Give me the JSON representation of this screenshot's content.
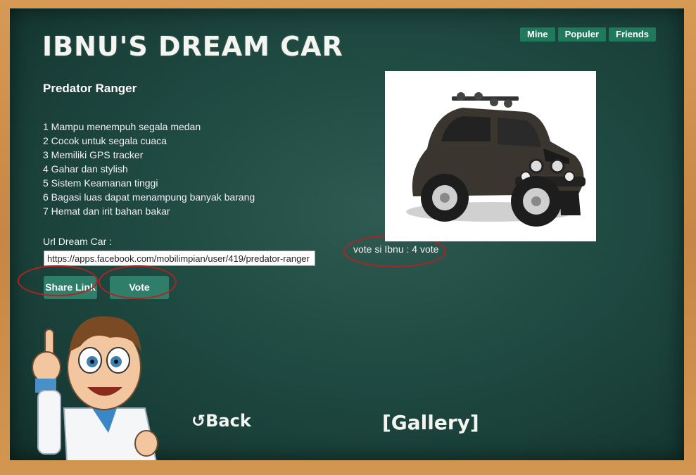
{
  "header": {
    "title": "IBNU'S DREAM CAR",
    "nav": [
      "Mine",
      "Populer",
      "Friends"
    ]
  },
  "car": {
    "name": "Predator Ranger",
    "features": [
      "1 Mampu menempuh segala medan",
      "2 Cocok untuk segala cuaca",
      "3 Memiliki GPS tracker",
      "4 Gahar dan stylish",
      "5 Sistem Keamanan tinggi",
      "6 Bagasi luas dapat menampung banyak barang",
      "7 Hemat dan irit bahan bakar"
    ],
    "image_icon": "suv-car-illustration"
  },
  "share": {
    "url_label": "Url Dream Car :",
    "url_value": "https://apps.facebook.com/mobilimpian/user/419/predator-ranger",
    "share_label": "Share Link",
    "vote_label": "Vote"
  },
  "votes": {
    "text": "vote si Ibnu : 4 vote"
  },
  "footer": {
    "back_label": "Back",
    "gallery_label": "[Gallery]"
  },
  "colors": {
    "board": "#1f4a42",
    "frame": "#c98d4a",
    "button": "#2f7e6a",
    "nav_button": "#1f7a5c",
    "highlight_ring": "#b32222"
  }
}
